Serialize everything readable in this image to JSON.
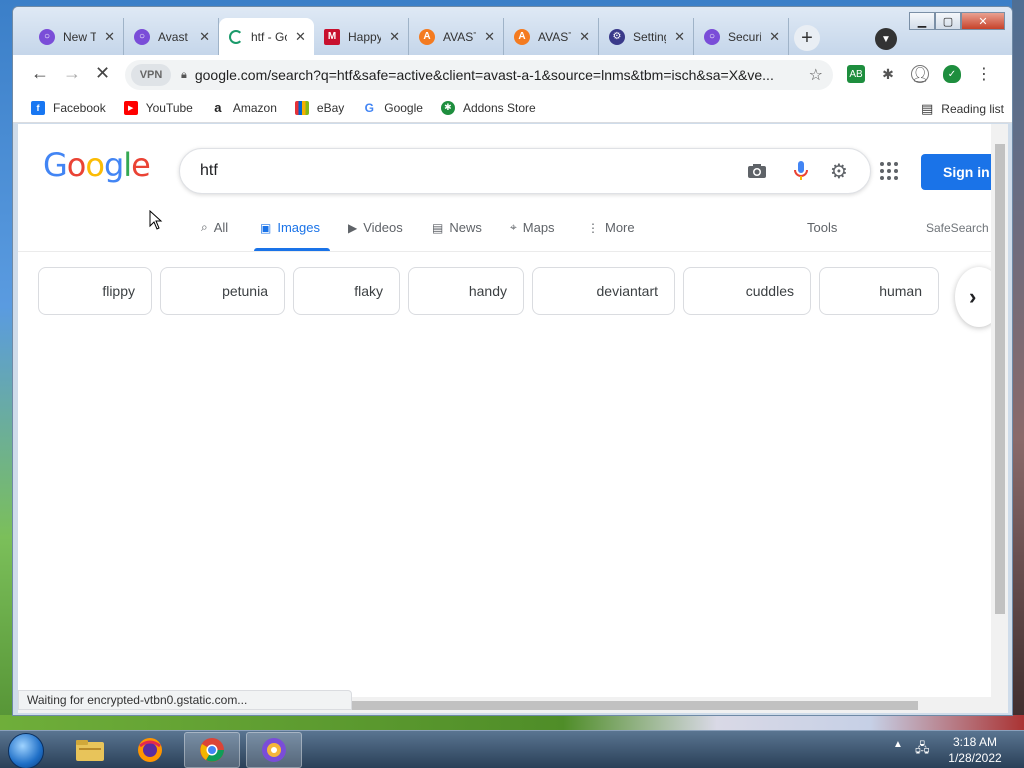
{
  "tabs": [
    {
      "label": "New Tab",
      "icon": "avast-browser-icon",
      "color": "#7a4dd8"
    },
    {
      "label": "Avast",
      "icon": "avast-browser-icon",
      "color": "#7a4dd8"
    },
    {
      "label": "htf - Google Search",
      "icon": "loading-spinner-icon",
      "color": "#1a9a6a"
    },
    {
      "label": "Happy",
      "icon": "mcafee-icon",
      "color": "#c8102e"
    },
    {
      "label": "AVAST",
      "icon": "avast-icon",
      "color": "#f47b20"
    },
    {
      "label": "AVAST",
      "icon": "avast-icon",
      "color": "#f47b20"
    },
    {
      "label": "Settings",
      "icon": "gear-icon",
      "color": "#3a3a8a"
    },
    {
      "label": "Security",
      "icon": "avast-browser-icon",
      "color": "#7a4dd8"
    }
  ],
  "toolbar": {
    "vpn_label": "VPN",
    "url": "google.com/search?q=htf&safe=active&client=avast-a-1&source=lnms&tbm=isch&sa=X&ve..."
  },
  "bookmarks": [
    {
      "label": "Facebook",
      "icon": "facebook-icon",
      "color": "#1877f2",
      "glyph": "f"
    },
    {
      "label": "YouTube",
      "icon": "youtube-icon",
      "color": "#ff0000",
      "glyph": "▶"
    },
    {
      "label": "Amazon",
      "icon": "amazon-icon",
      "color": "#222222",
      "glyph": "a"
    },
    {
      "label": "eBay",
      "icon": "ebay-icon",
      "color": "#e53238",
      "glyph": "e"
    },
    {
      "label": "Google",
      "icon": "google-icon",
      "color": "#4285f4",
      "glyph": "G"
    },
    {
      "label": "Addons Store",
      "icon": "addons-store-icon",
      "color": "#1e8e3e",
      "glyph": "✱"
    }
  ],
  "reading_list": "Reading list",
  "google": {
    "logo": [
      "G",
      "o",
      "o",
      "g",
      "l",
      "e"
    ],
    "query": "htf",
    "sign_in": "Sign in",
    "nav": [
      {
        "label": "All",
        "icon": "search-icon",
        "glyph": "⌕"
      },
      {
        "label": "Images",
        "icon": "image-icon",
        "glyph": "▣"
      },
      {
        "label": "Videos",
        "icon": "video-icon",
        "glyph": "▶"
      },
      {
        "label": "News",
        "icon": "news-icon",
        "glyph": "▤"
      },
      {
        "label": "Maps",
        "icon": "map-pin-icon",
        "glyph": "⌖"
      },
      {
        "label": "More",
        "icon": "more-vert-icon",
        "glyph": "⋮"
      }
    ],
    "tools": "Tools",
    "safesearch": "SafeSearch",
    "chips": [
      "flippy",
      "petunia",
      "flaky",
      "handy",
      "deviantart",
      "cuddles",
      "human"
    ]
  },
  "status_text": "Waiting for encrypted-vtbn0.gstatic.com...",
  "clock": {
    "time": "3:18 AM",
    "date": "1/28/2022"
  }
}
